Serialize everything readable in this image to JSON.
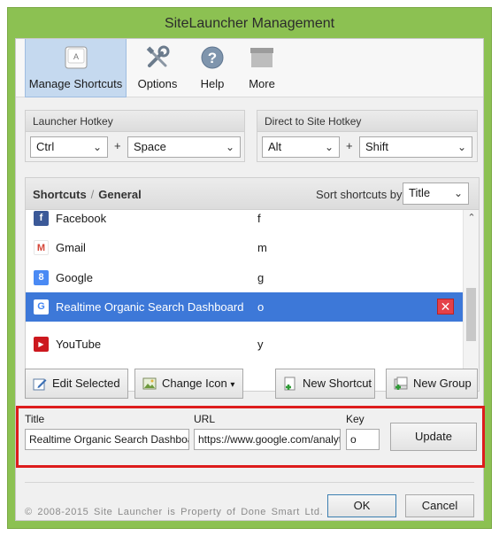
{
  "window": {
    "title": "SiteLauncher Management"
  },
  "ribbon": {
    "items": [
      {
        "label": "Manage Shortcuts",
        "icon": "keyboard-key-icon",
        "active": true
      },
      {
        "label": "Options",
        "icon": "tools-icon"
      },
      {
        "label": "Help",
        "icon": "help-icon"
      },
      {
        "label": "More",
        "icon": "more-icon"
      }
    ],
    "key_glyph": "A",
    "help_glyph": "?"
  },
  "launcher_hotkey": {
    "label": "Launcher Hotkey",
    "modifier": "Ctrl",
    "plus": "+",
    "key": "Space"
  },
  "direct_hotkey": {
    "label": "Direct to Site Hotkey",
    "modifier": "Alt",
    "plus": "+",
    "key": "Shift"
  },
  "shortcuts": {
    "breadcrumb_root": "Shortcuts",
    "breadcrumb_sep": "/",
    "breadcrumb_current": "General",
    "sort_label": "Sort shortcuts by:",
    "sort_value": "Title",
    "rows": [
      {
        "name": "Facebook",
        "key": "f",
        "icon": "facebook-icon",
        "glyph": "f",
        "color": "#3b5998"
      },
      {
        "name": "Gmail",
        "key": "m",
        "icon": "gmail-icon",
        "glyph": "M",
        "color": "#d44638"
      },
      {
        "name": "Google",
        "key": "g",
        "icon": "google-icon",
        "glyph": "8",
        "color": "#4a8af4"
      },
      {
        "name": "Realtime Organic Search Dashboard",
        "key": "o",
        "icon": "google-g-icon",
        "glyph": "G",
        "color": "#ffffff",
        "selected": true
      },
      {
        "name": "YouTube",
        "key": "y",
        "icon": "youtube-icon",
        "glyph": "▶",
        "color": "#cc181e"
      }
    ],
    "delete_glyph": "✕"
  },
  "actions": {
    "edit_selected": "Edit Selected",
    "change_icon": "Change Icon",
    "change_icon_arrow": "▾",
    "new_shortcut": "New Shortcut",
    "new_group": "New Group"
  },
  "editor": {
    "title_label": "Title",
    "title_value": "Realtime Organic Search Dashboard",
    "url_label": "URL",
    "url_value": "https://www.google.com/analytics",
    "key_label": "Key",
    "key_value": "o",
    "update_label": "Update"
  },
  "footer": {
    "copyright": "© 2008-2015 Site Launcher is Property of Done Smart Ltd.",
    "ok": "OK",
    "cancel": "Cancel"
  },
  "colors": {
    "frame": "#8cc152",
    "selection": "#3d78d8",
    "highlight_border": "#dd1c1c"
  }
}
